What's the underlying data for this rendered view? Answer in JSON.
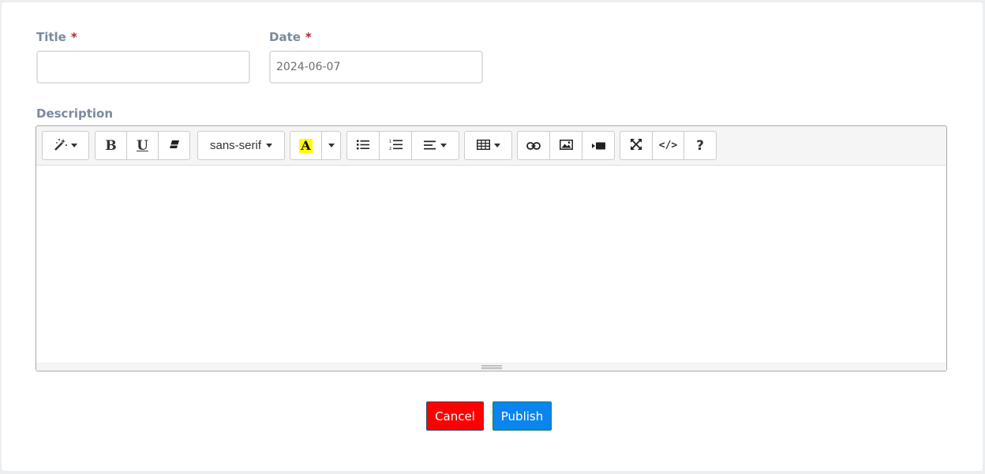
{
  "form": {
    "title_label": "Title",
    "date_label": "Date",
    "required_marker": "*",
    "title_value": "",
    "date_value": "2024-06-07",
    "description_label": "Description"
  },
  "toolbar": {
    "style_icon": "magic-wand-icon",
    "bold_label": "B",
    "underline_label": "U",
    "clear_format_icon": "eraser-icon",
    "font_name": "sans-serif",
    "forecolor_label": "A",
    "forecolor_highlight": "#ffff00",
    "unordered_list_icon": "unordered-list-icon",
    "ordered_list_icon": "ordered-list-icon",
    "align_icon": "align-left-icon",
    "table_icon": "table-icon",
    "link_icon": "link-icon",
    "picture_icon": "picture-icon",
    "video_icon": "video-icon",
    "fullscreen_icon": "fullscreen-icon",
    "code_label": "</>",
    "help_label": "?"
  },
  "actions": {
    "cancel_label": "Cancel",
    "publish_label": "Publish",
    "cancel_color": "#ff0000",
    "publish_color": "#0a84ef"
  }
}
